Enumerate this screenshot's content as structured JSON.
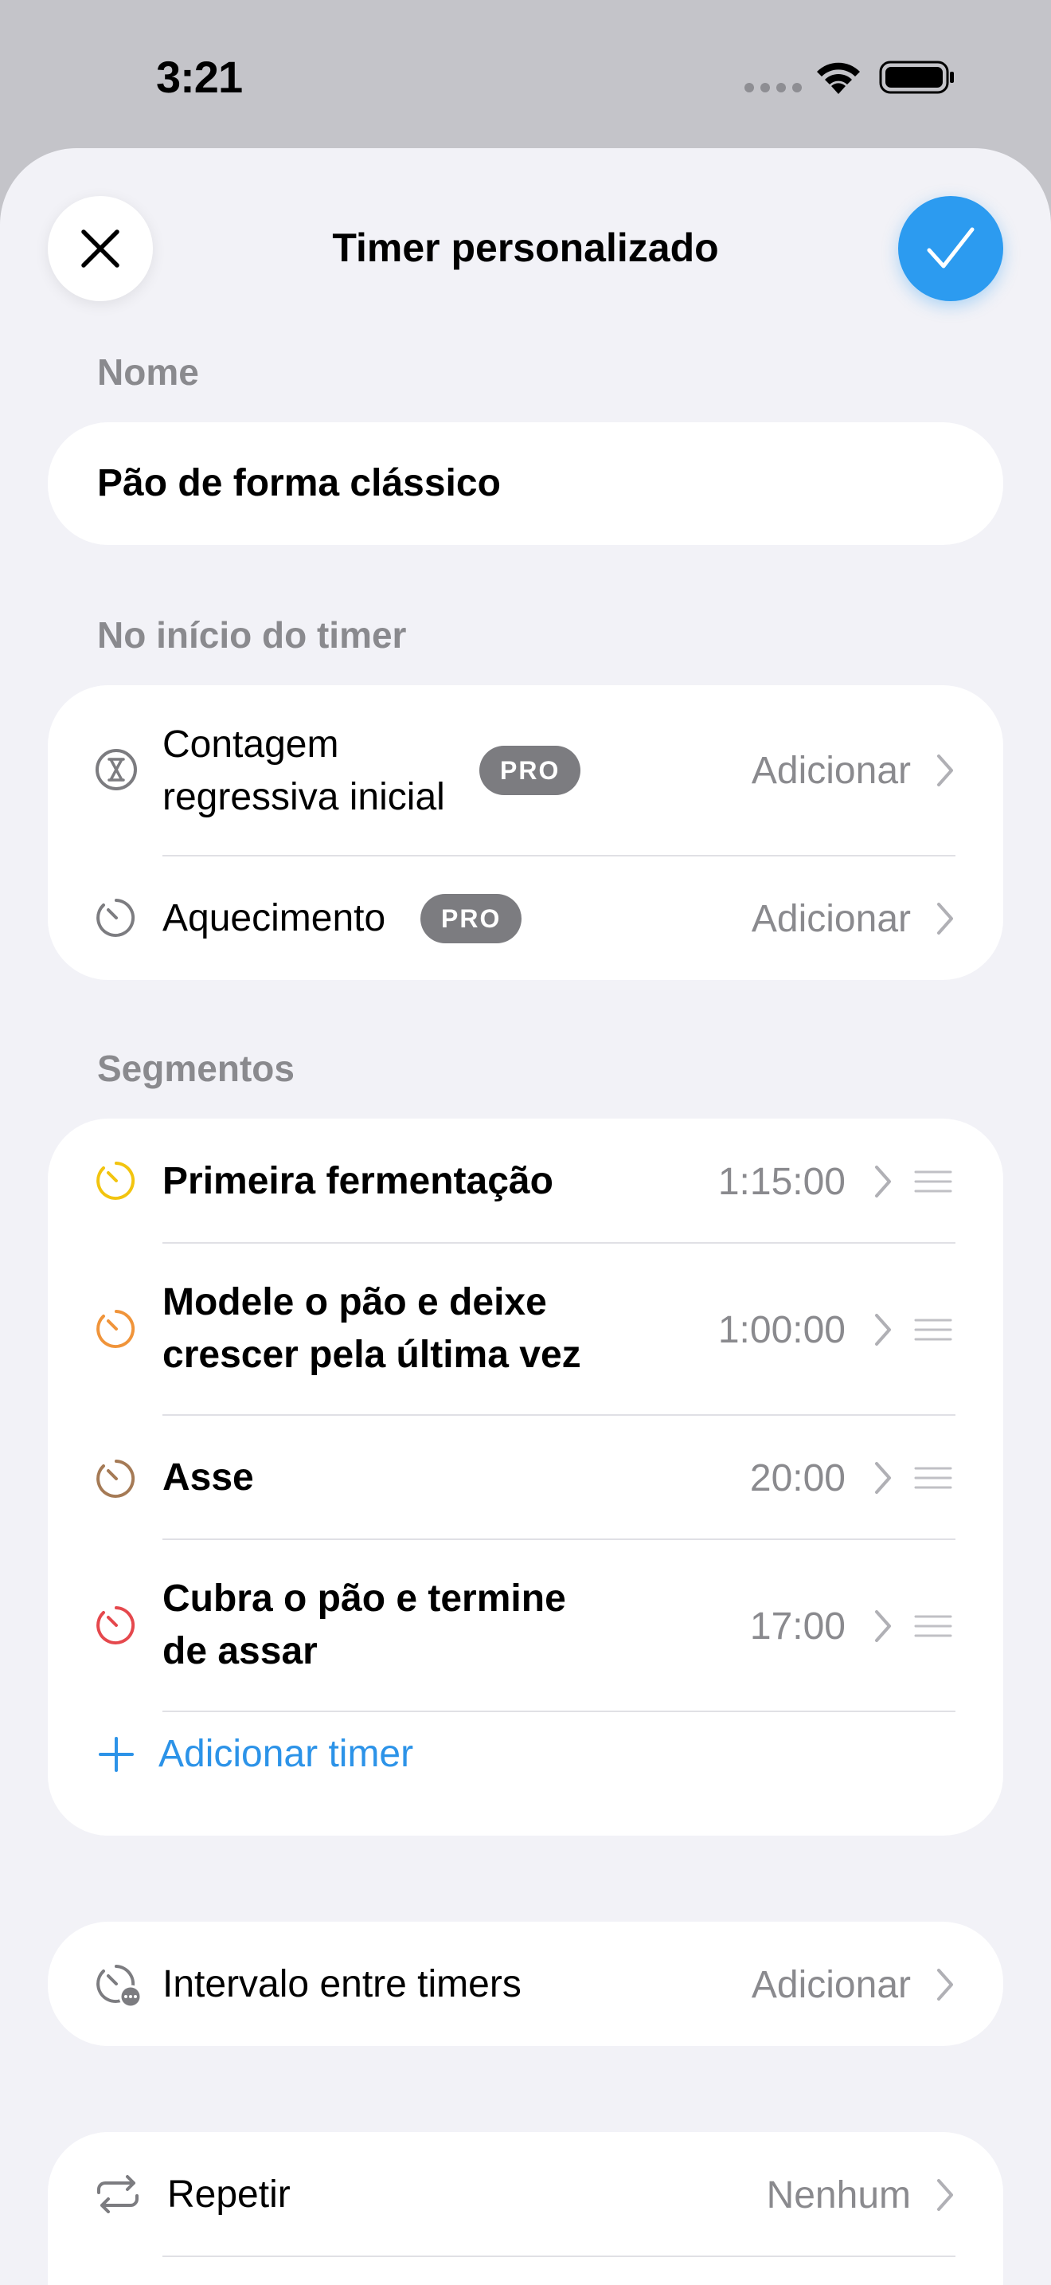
{
  "status_bar": {
    "time": "3:21"
  },
  "header": {
    "title": "Timer personalizado"
  },
  "name_section": {
    "label": "Nome",
    "value": "Pão de forma clássico"
  },
  "start_section": {
    "label": "No início do timer",
    "items": [
      {
        "label": "Contagem regressiva inicial",
        "badge": "PRO",
        "value": "Adicionar"
      },
      {
        "label": "Aquecimento",
        "badge": "PRO",
        "value": "Adicionar"
      }
    ]
  },
  "segments_section": {
    "label": "Segmentos",
    "items": [
      {
        "label": "Primeira fermentação",
        "duration": "1:15:00",
        "icon_color": "#f2c40f"
      },
      {
        "label": "Modele o pão e deixe crescer pela última vez",
        "duration": "1:00:00",
        "icon_color": "#f0943a"
      },
      {
        "label": "Asse",
        "duration": "20:00",
        "icon_color": "#a57a55"
      },
      {
        "label": "Cubra o pão e termine de assar",
        "duration": "17:00",
        "icon_color": "#e5484d"
      }
    ],
    "add_label": "Adicionar timer"
  },
  "interval": {
    "label": "Intervalo entre timers",
    "value": "Adicionar"
  },
  "repeat": {
    "label": "Repetir",
    "value": "Nenhum"
  },
  "colors": {
    "accent": "#2c9bf0",
    "link": "#2c93e8",
    "secondary_text": "#8a8a8e",
    "pro_badge": "#7c7c80"
  },
  "icons": [
    "close-icon",
    "checkmark-icon",
    "hourglass-icon",
    "stopwatch-icon",
    "chevron-right-icon",
    "drag-handle-icon",
    "plus-icon",
    "interval-icon",
    "repeat-icon",
    "wifi-icon",
    "battery-icon"
  ]
}
